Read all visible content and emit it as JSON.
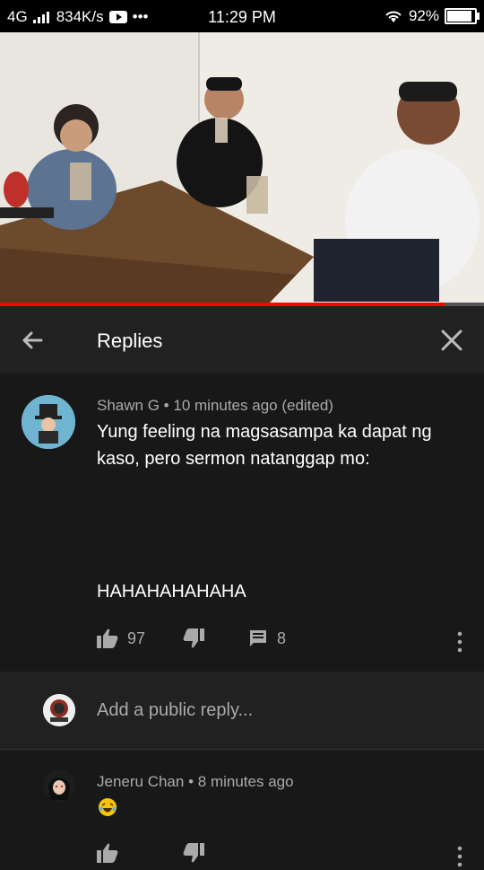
{
  "status_bar": {
    "network": "4G",
    "speed": "834K/s",
    "time": "11:29 PM",
    "battery": "92%",
    "battery_level": 0.92
  },
  "video": {
    "progress": 0.92
  },
  "replies_header": {
    "title": "Replies"
  },
  "comment": {
    "author": "Shawn G",
    "time": "10 minutes ago (edited)",
    "text": "Yung feeling na magsasampa ka dapat ng kaso, pero sermon natanggap mo:",
    "text_line2": "HAHAHAHAHAHA",
    "likes": "97",
    "replies_count": "8"
  },
  "add_reply": {
    "placeholder": "Add a public reply..."
  },
  "reply": {
    "author": "Jeneru Chan",
    "time": "8 minutes ago"
  },
  "colors": {
    "accent": "#ff0000",
    "background": "#181818",
    "panel": "#212121",
    "muted_text": "#aaaaaa"
  },
  "icons": [
    "back-arrow-icon",
    "close-icon",
    "thumbs-up-icon",
    "thumbs-down-icon",
    "reply-icon",
    "more-vert-icon",
    "emoji-icon",
    "youtube-icon",
    "wifi-icon",
    "battery-icon"
  ]
}
